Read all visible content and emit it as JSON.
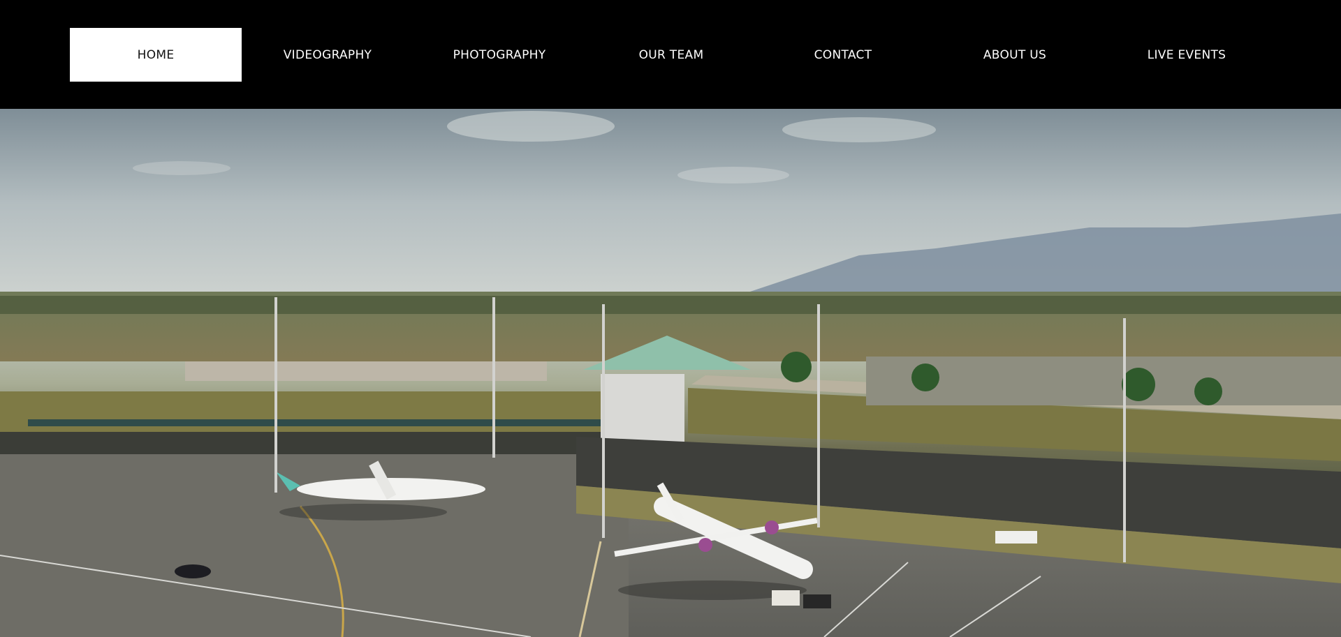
{
  "nav": {
    "items": [
      {
        "label": "HOME",
        "active": true
      },
      {
        "label": "VIDEOGRAPHY",
        "active": false
      },
      {
        "label": "PHOTOGRAPHY",
        "active": false
      },
      {
        "label": "OUR TEAM",
        "active": false
      },
      {
        "label": "CONTACT",
        "active": false
      },
      {
        "label": "ABOUT US",
        "active": false
      },
      {
        "label": "LIVE EVENTS",
        "active": false
      }
    ]
  },
  "hero": {
    "image_subject": "aerial view of airport terminal with two propeller aircraft on apron, mountains in background"
  },
  "colors": {
    "header_bg": "#000000",
    "active_tab_bg": "#ffffff",
    "active_tab_text": "#111111",
    "nav_text": "#ffffff"
  }
}
